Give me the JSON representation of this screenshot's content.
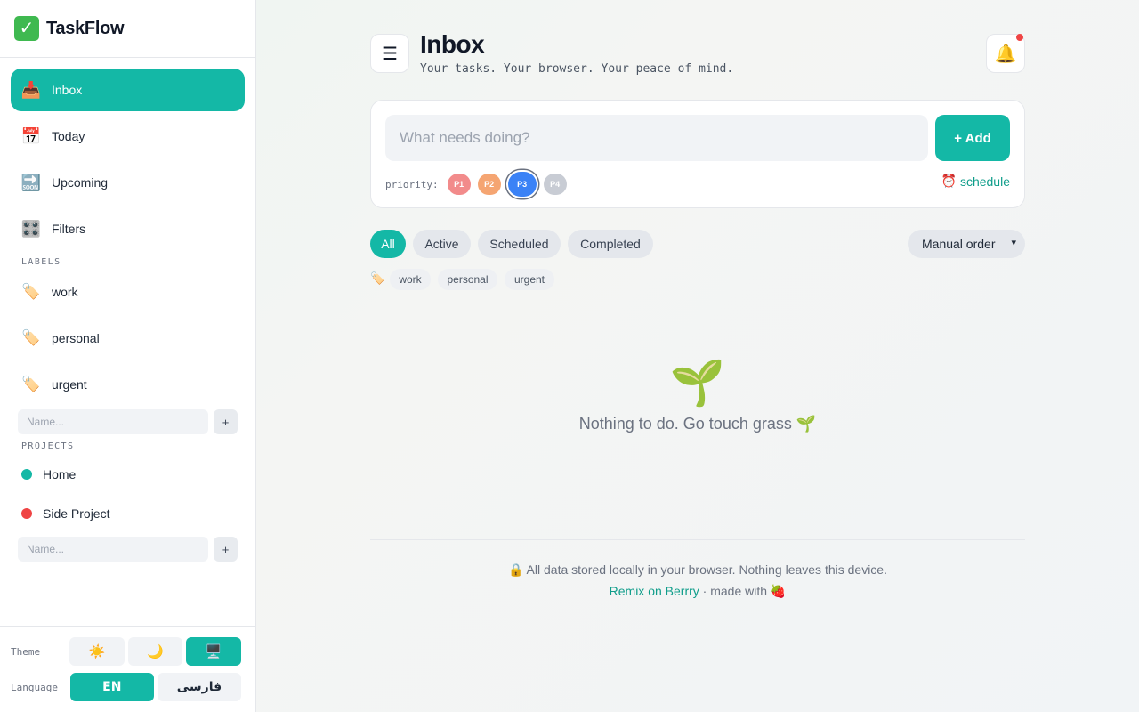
{
  "brand": {
    "icon": "check-mark-icon",
    "name": "TaskFlow"
  },
  "nav": {
    "items": [
      {
        "label": "Inbox",
        "icon": "inbox-tray-icon",
        "glyph": "📥",
        "active": true
      },
      {
        "label": "Today",
        "icon": "calendar-icon",
        "glyph": "📅",
        "active": false
      },
      {
        "label": "Upcoming",
        "icon": "soon-arrow-icon",
        "glyph": "🔜",
        "active": false
      },
      {
        "label": "Filters",
        "icon": "control-knobs-icon",
        "glyph": "🎛️",
        "active": false
      }
    ]
  },
  "labels_section": {
    "title": "LABELS",
    "items": [
      "work",
      "personal",
      "urgent"
    ],
    "icon": "tag-icon",
    "input_placeholder": "Name...",
    "add_label": "+"
  },
  "projects_section": {
    "title": "PROJECTS",
    "items": [
      {
        "name": "Home",
        "color": "#14b8a6"
      },
      {
        "name": "Side Project",
        "color": "#ef4444"
      }
    ],
    "input_placeholder": "Name...",
    "add_label": "+"
  },
  "settings": {
    "theme_label": "Theme",
    "theme_options": [
      {
        "icon": "sun-icon",
        "glyph": "☀️",
        "active": false
      },
      {
        "icon": "moon-icon",
        "glyph": "🌙",
        "active": false
      },
      {
        "icon": "desktop-icon",
        "glyph": "🖥️",
        "active": true
      }
    ],
    "language_label": "Language",
    "language_options": [
      {
        "label": "EN",
        "active": true
      },
      {
        "label": "فارسی",
        "active": false
      }
    ]
  },
  "header": {
    "menu_icon": "hamburger-menu-icon",
    "title": "Inbox",
    "subtitle": "Your tasks. Your browser. Your peace of mind.",
    "bell_icon": "bell-icon",
    "has_notification": true
  },
  "composer": {
    "placeholder": "What needs doing?",
    "add_label": "+ Add",
    "priority_label": "priority:",
    "priorities": [
      {
        "label": "P1",
        "selected": false
      },
      {
        "label": "P2",
        "selected": false
      },
      {
        "label": "P3",
        "selected": true
      },
      {
        "label": "P4",
        "selected": false
      }
    ],
    "schedule_icon": "alarm-clock-icon",
    "schedule_label": "schedule"
  },
  "filters": {
    "tabs": [
      {
        "label": "All",
        "active": true
      },
      {
        "label": "Active",
        "active": false
      },
      {
        "label": "Scheduled",
        "active": false
      },
      {
        "label": "Completed",
        "active": false
      }
    ],
    "sort_selected": "Manual order"
  },
  "label_filters": [
    "work",
    "personal",
    "urgent"
  ],
  "empty_state": {
    "icon": "seedling-icon",
    "text": "Nothing to do. Go touch grass 🌱"
  },
  "footer": {
    "privacy_text": "🔒 All data stored locally in your browser. Nothing leaves this device.",
    "remix_link": "Remix on Berrry",
    "made_with": "· made with 🍓"
  },
  "colors": {
    "accent": "#14b8a6",
    "p1": "#f28b8b",
    "p2": "#f5a572",
    "p3": "#3b82f6",
    "p4": "#c8ccd4",
    "danger": "#ef4444"
  }
}
